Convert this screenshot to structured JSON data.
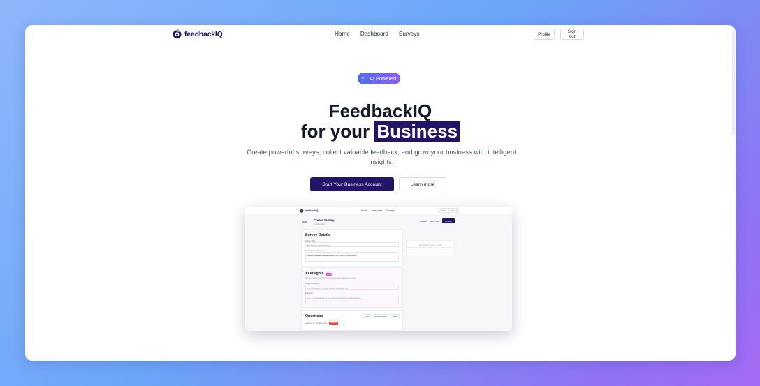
{
  "app": {
    "name": "feedbackIQ",
    "brand_color": "#241468",
    "accent_gradient": [
      "#4f6ff0",
      "#8b5cf6"
    ]
  },
  "nav": {
    "links": [
      "Home",
      "Dashboard",
      "Surveys"
    ],
    "profile_label": "Profile",
    "signout_label": "Sign out"
  },
  "hero": {
    "badge_label": "AI Powered",
    "badge_icon": "sparkle-icon",
    "title_line1": "FeedbackIQ",
    "title_line2_prefix": "for your",
    "title_highlight": "Business",
    "subtitle": "Create powerful surveys, collect valuable feedback, and grow your business with intelligent insights.",
    "primary_cta": "Start Your Business Account",
    "secondary_cta": "Learn more"
  },
  "preview": {
    "logo": "feedbackIQ",
    "nav_links": [
      "Home",
      "Dashboard",
      "Surveys"
    ],
    "nav_buttons": [
      "Profile",
      "Sign out"
    ],
    "back_label": "Back",
    "page_title": "Create Survey",
    "page_subtitle": "Untitled draft",
    "actions": [
      "Preview",
      "Save draft",
      "Publish"
    ],
    "details": {
      "title": "Survey Details",
      "title_label": "Survey Title",
      "title_value": "Product Feedback Survey",
      "desc_label": "Description (Optional)",
      "desc_value": "Gather valuable feedback about our products or services"
    },
    "ai": {
      "title": "AI Insights",
      "badge": "New",
      "description": "Get AI-powered insights by providing context about your survey",
      "audience_label": "Target Audience",
      "audience_placeholder": "e.g. Customers, Product Owners, Students, etc.",
      "purpose_label": "Purpose",
      "purpose_placeholder": "e.g. to get feedback on our recent restaurant / coffee features"
    },
    "sidebar": {
      "title": "Select a question to edit",
      "subtitle": "Click on a question from the list to view or edit its settings"
    },
    "questions": {
      "title": "Questions",
      "buttons": [
        "Text",
        "Multiple Choice",
        "Rating"
      ],
      "first_row_label": "Question 1",
      "first_row_type": "Single choice",
      "first_row_badge": "Required"
    }
  }
}
